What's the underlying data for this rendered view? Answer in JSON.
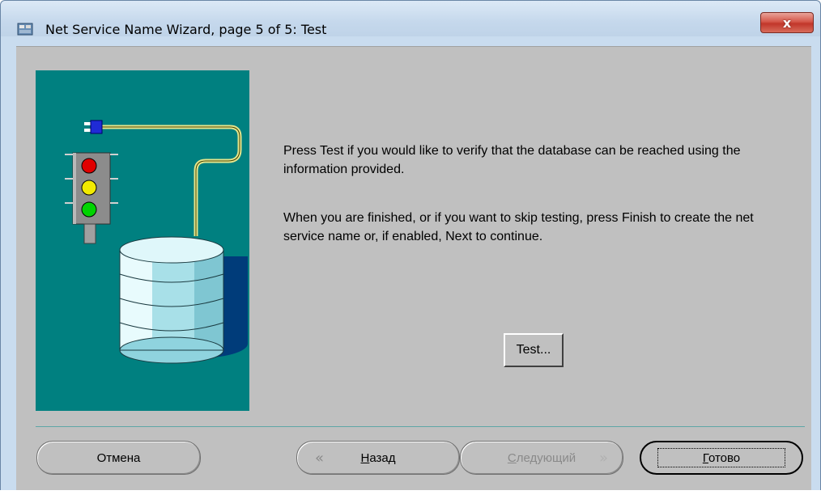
{
  "window": {
    "title": "Net Service Name Wizard, page 5 of 5: Test",
    "close_label": "x"
  },
  "content": {
    "message_1": "Press Test if you would like to verify that the database can be reached using the information provided.",
    "message_2": "When you are finished, or if you want to skip testing, press Finish to create the net service name or, if enabled, Next to continue.",
    "test_button": "Test..."
  },
  "buttons": {
    "cancel": "Отмена",
    "back_mnemonic": "Н",
    "back_rest": "азад",
    "next_mnemonic": "С",
    "next_rest": "ледующий",
    "finish_mnemonic": "Г",
    "finish_rest": "отово",
    "next_enabled": false
  },
  "colors": {
    "illustration_bg": "#008080",
    "dialog_bg": "#c0c0c0",
    "titlebar": "#c9dcef",
    "close_red": "#c1362a"
  }
}
